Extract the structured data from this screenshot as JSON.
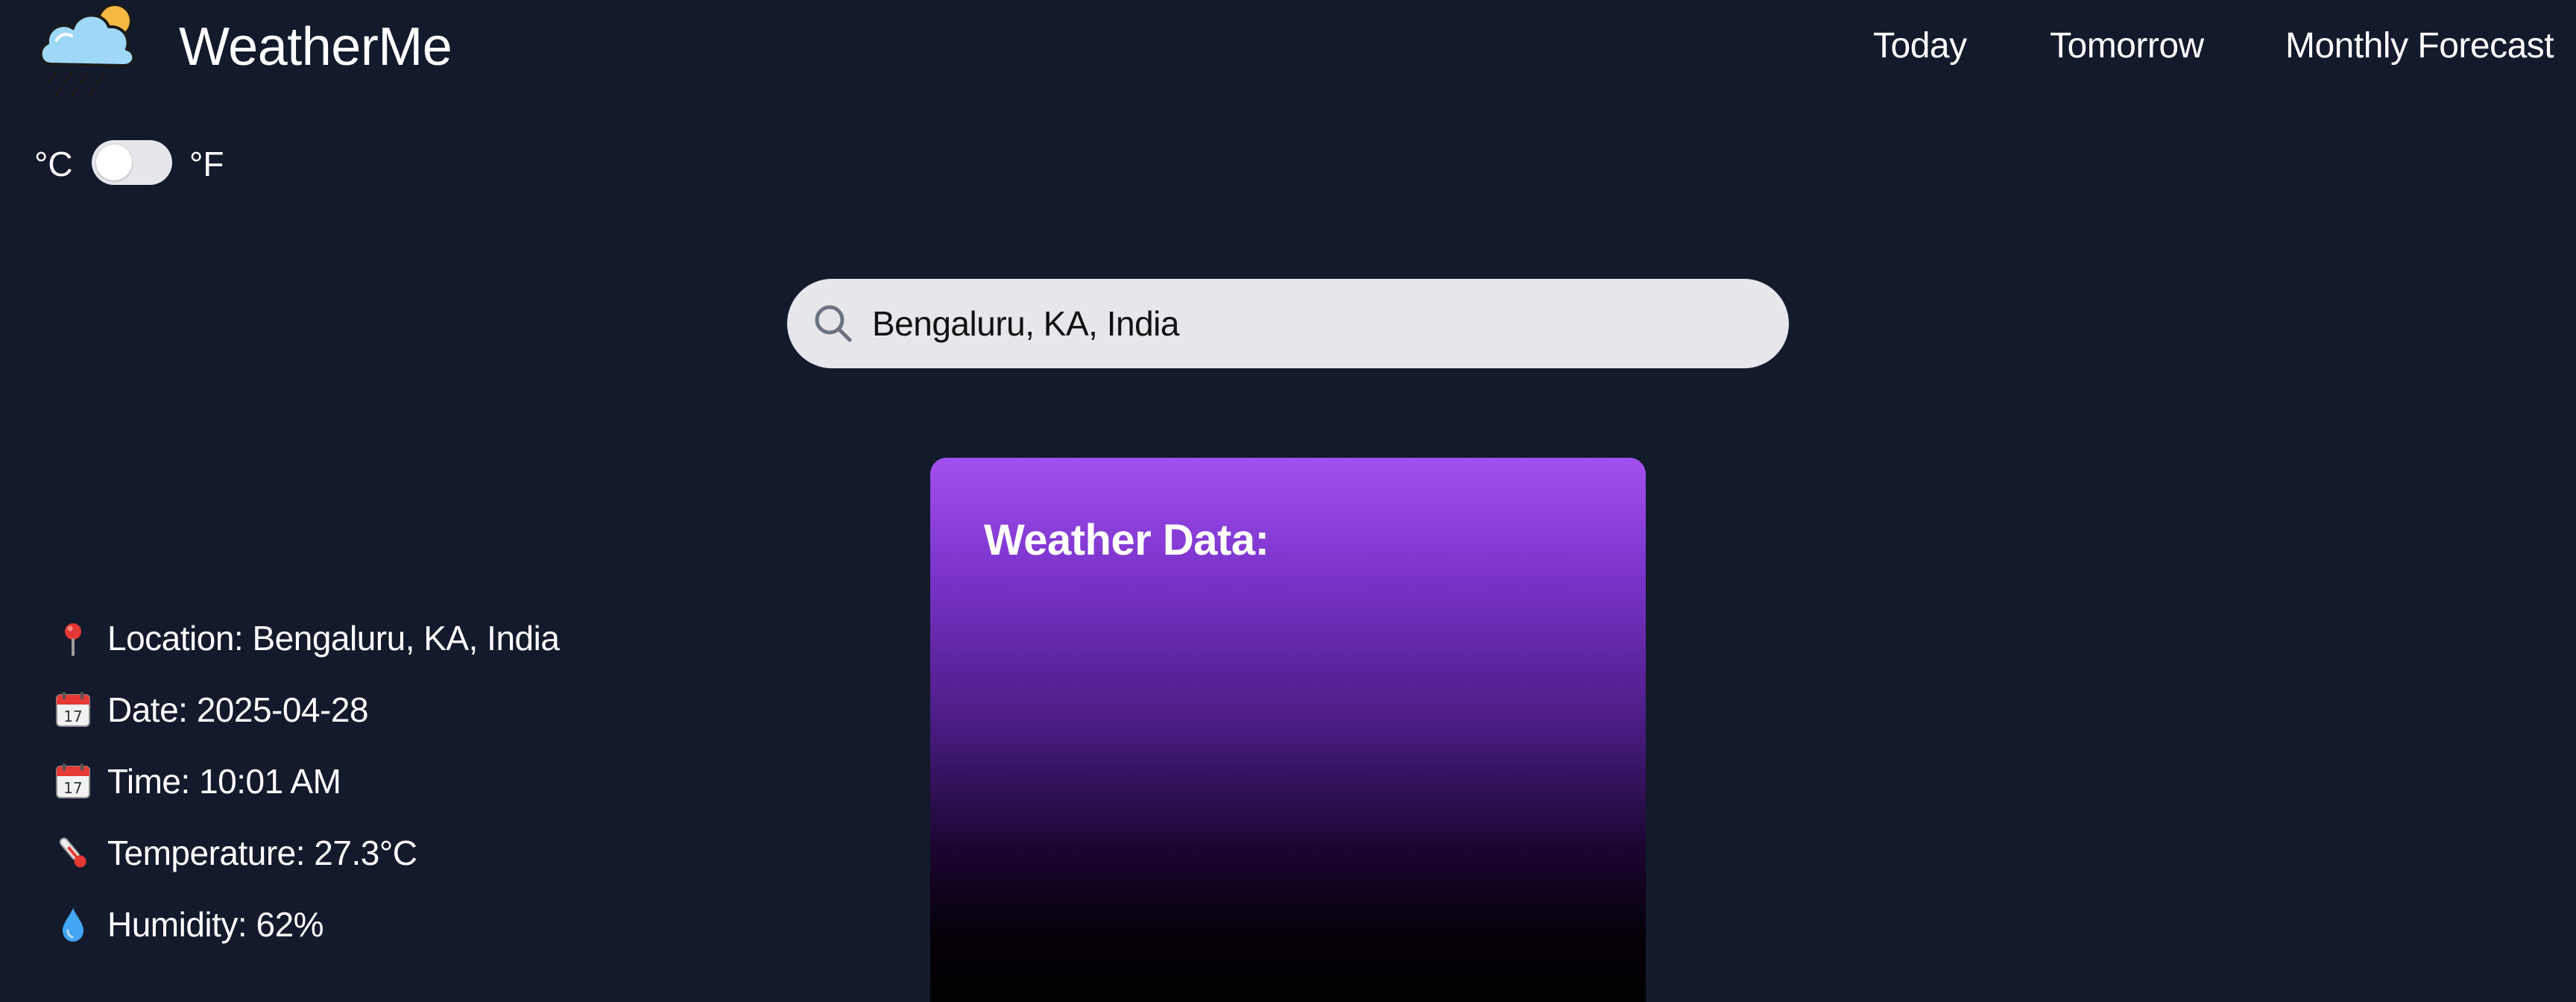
{
  "app": {
    "brand": "WeatherMe",
    "logo_icon": "cloud-sun-rain-icon"
  },
  "nav": {
    "today": "Today",
    "tomorrow": "Tomorrow",
    "monthly": "Monthly Forecast"
  },
  "units": {
    "celsius": "°C",
    "fahrenheit": "°F",
    "selected": "°C"
  },
  "search": {
    "value": "Bengaluru, KA, India",
    "icon": "search-icon"
  },
  "weather": {
    "title": "Weather Data:",
    "location": "Location: Bengaluru, KA, India",
    "date": "Date: 2025-04-28",
    "time": "Time: 10:01 AM",
    "temperature": "Temperature: 27.3°C",
    "humidity": "Humidity: 62%"
  },
  "colors": {
    "background": "#131a2b",
    "card_gradient_top": "#a24ff0",
    "card_gradient_bottom": "#000000",
    "search_bg": "#e5e7eb"
  }
}
